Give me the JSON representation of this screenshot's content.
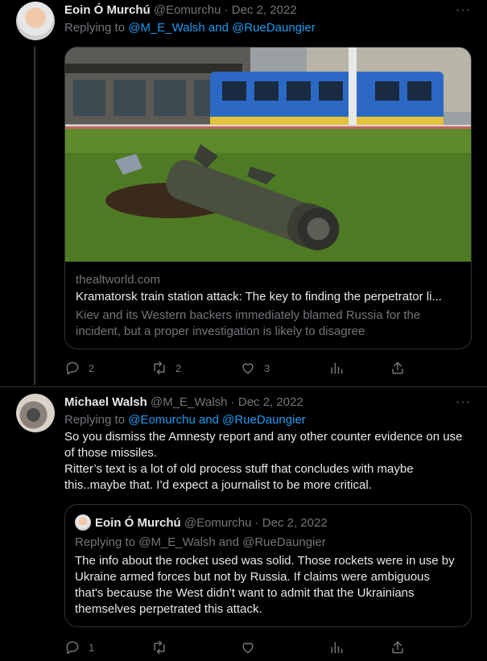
{
  "tweet1": {
    "author_name": "Eoin Ó Murchú",
    "handle": "@Eomurchu",
    "separator": " · ",
    "date": "Dec 2, 2022",
    "replying_prefix": "Replying to ",
    "replying_to": "@M_E_Walsh and @RueDaungier",
    "more_icon_label": "···",
    "card": {
      "domain": "thealtworld.com",
      "title": "Kramatorsk train station attack: The key to finding the perpetrator li...",
      "description": "Kiev and its Western backers immediately blamed Russia for the incident, but a proper investigation is likely to disagree"
    },
    "actions": {
      "replies": "2",
      "retweets": "2",
      "likes": "3"
    }
  },
  "tweet2": {
    "author_name": "Michael Walsh",
    "handle": "@M_E_Walsh",
    "separator": " · ",
    "date": "Dec 2, 2022",
    "replying_prefix": "Replying to ",
    "replying_to": "@Eomurchu and @RueDaungier",
    "more_icon_label": "···",
    "text_line1": "So you dismiss the Amnesty report and any other counter evidence on use of those missiles.",
    "text_line2": "Ritter’s text is a lot of old process stuff that concludes with maybe this..maybe that. I’d expect a journalist to be more critical.",
    "quote": {
      "author_name": "Eoin Ó Murchú",
      "handle": "@Eomurchu",
      "separator": " · ",
      "date": "Dec 2, 2022",
      "replying": "Replying to @M_E_Walsh and @RueDaungier",
      "text": "The info about the rocket used was solid.  Those rockets were in use by Ukraine armed forces but not by Russia. If claims were ambiguous that's because the West didn't want to admit that the Ukrainians themselves perpetrated this attack."
    },
    "actions": {
      "replies": "1"
    }
  },
  "icons": [
    "reply-icon",
    "retweet-icon",
    "like-icon",
    "views-icon",
    "share-icon",
    "more-icon"
  ],
  "colors": {
    "background": "#000000",
    "text": "#e7e9ea",
    "muted": "#71767b",
    "link": "#1d9bf0",
    "border": "#2f3336"
  }
}
